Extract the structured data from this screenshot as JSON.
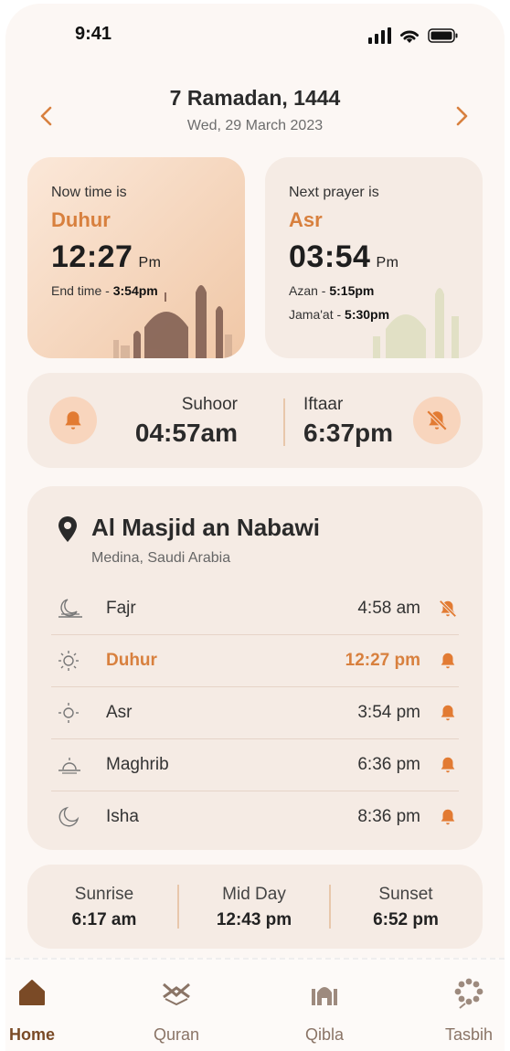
{
  "status": {
    "time": "9:41"
  },
  "header": {
    "hijri_date": "7 Ramadan, 1444",
    "greg_date": "Wed, 29 March 2023"
  },
  "now_card": {
    "label": "Now time is",
    "prayer": "Duhur",
    "time": "12:27",
    "ampm": "Pm",
    "end_label": "End time - ",
    "end_time": "3:54pm"
  },
  "next_card": {
    "label": "Next prayer is",
    "prayer": "Asr",
    "time": "03:54",
    "ampm": "Pm",
    "azan_label": "Azan - ",
    "azan_time": "5:15pm",
    "jamaat_label": "Jama'at - ",
    "jamaat_time": "5:30pm"
  },
  "fasting": {
    "suhoor_label": "Suhoor",
    "suhoor_time": "04:57am",
    "iftaar_label": "Iftaar",
    "iftaar_time": "6:37pm"
  },
  "masjid": {
    "name": "Al Masjid an Nabawi",
    "location": "Medina, Saudi Arabia",
    "prayers": [
      {
        "name": "Fajr",
        "time": "4:58 am",
        "icon": "fajr-icon",
        "alarm": "off"
      },
      {
        "name": "Duhur",
        "time": "12:27 pm",
        "icon": "sun-icon",
        "alarm": "on",
        "active": true
      },
      {
        "name": "Asr",
        "time": "3:54 pm",
        "icon": "afternoon-sun-icon",
        "alarm": "on"
      },
      {
        "name": "Maghrib",
        "time": "6:36 pm",
        "icon": "sunset-icon",
        "alarm": "on"
      },
      {
        "name": "Isha",
        "time": "8:36 pm",
        "icon": "moon-icon",
        "alarm": "on"
      }
    ]
  },
  "sun_times": [
    {
      "label": "Sunrise",
      "time": "6:17 am"
    },
    {
      "label": "Mid Day",
      "time": "12:43 pm"
    },
    {
      "label": "Sunset",
      "time": "6:52 pm"
    }
  ],
  "tabs": [
    {
      "label": "Home",
      "icon": "home-icon",
      "active": true
    },
    {
      "label": "Quran",
      "icon": "quran-icon"
    },
    {
      "label": "Qibla",
      "icon": "qibla-icon"
    },
    {
      "label": "Tasbih",
      "icon": "tasbih-icon"
    }
  ],
  "colors": {
    "accent": "#d8803e",
    "background": "#fcf7f4",
    "card": "#f5ebe4"
  }
}
